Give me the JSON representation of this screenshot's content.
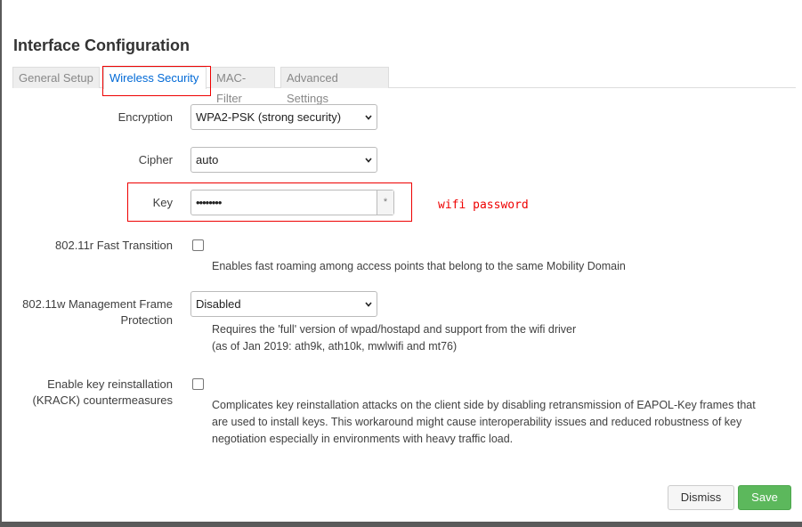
{
  "dialog": {
    "title": "Interface Configuration"
  },
  "tabs": [
    {
      "label": "General Setup",
      "active": false
    },
    {
      "label": "Wireless Security",
      "active": true
    },
    {
      "label": "MAC-Filter",
      "active": false
    },
    {
      "label": "Advanced Settings",
      "active": false
    }
  ],
  "form": {
    "encryption": {
      "label": "Encryption",
      "value": "WPA2-PSK (strong security)"
    },
    "cipher": {
      "label": "Cipher",
      "value": "auto"
    },
    "key": {
      "label": "Key",
      "value": "••••••••",
      "reveal_symbol": "*"
    },
    "fast_transition": {
      "label": "802.11r Fast Transition",
      "checked": false,
      "help": "Enables fast roaming among access points that belong to the same Mobility Domain"
    },
    "mgmt_frame": {
      "label_line1": "802.11w Management Frame",
      "label_line2": "Protection",
      "value": "Disabled",
      "help_line1": "Requires the 'full' version of wpad/hostapd and support from the wifi driver",
      "help_line2": "(as of Jan 2019: ath9k, ath10k, mwlwifi and mt76)"
    },
    "krack": {
      "label_line1": "Enable key reinstallation",
      "label_line2": "(KRACK) countermeasures",
      "checked": false,
      "help_line1": "Complicates key reinstallation attacks on the client side by disabling retransmission of EAPOL-Key frames that",
      "help_line2": "are used to install keys. This workaround might cause interoperability issues and reduced robustness of key",
      "help_line3": "negotiation especially in environments with heavy traffic load."
    }
  },
  "annotation": {
    "text": "wifi password",
    "color": "#e00000"
  },
  "buttons": {
    "dismiss": "Dismiss",
    "save": "Save"
  },
  "colors": {
    "accent": "#0069d6",
    "save": "#5cb85c"
  }
}
